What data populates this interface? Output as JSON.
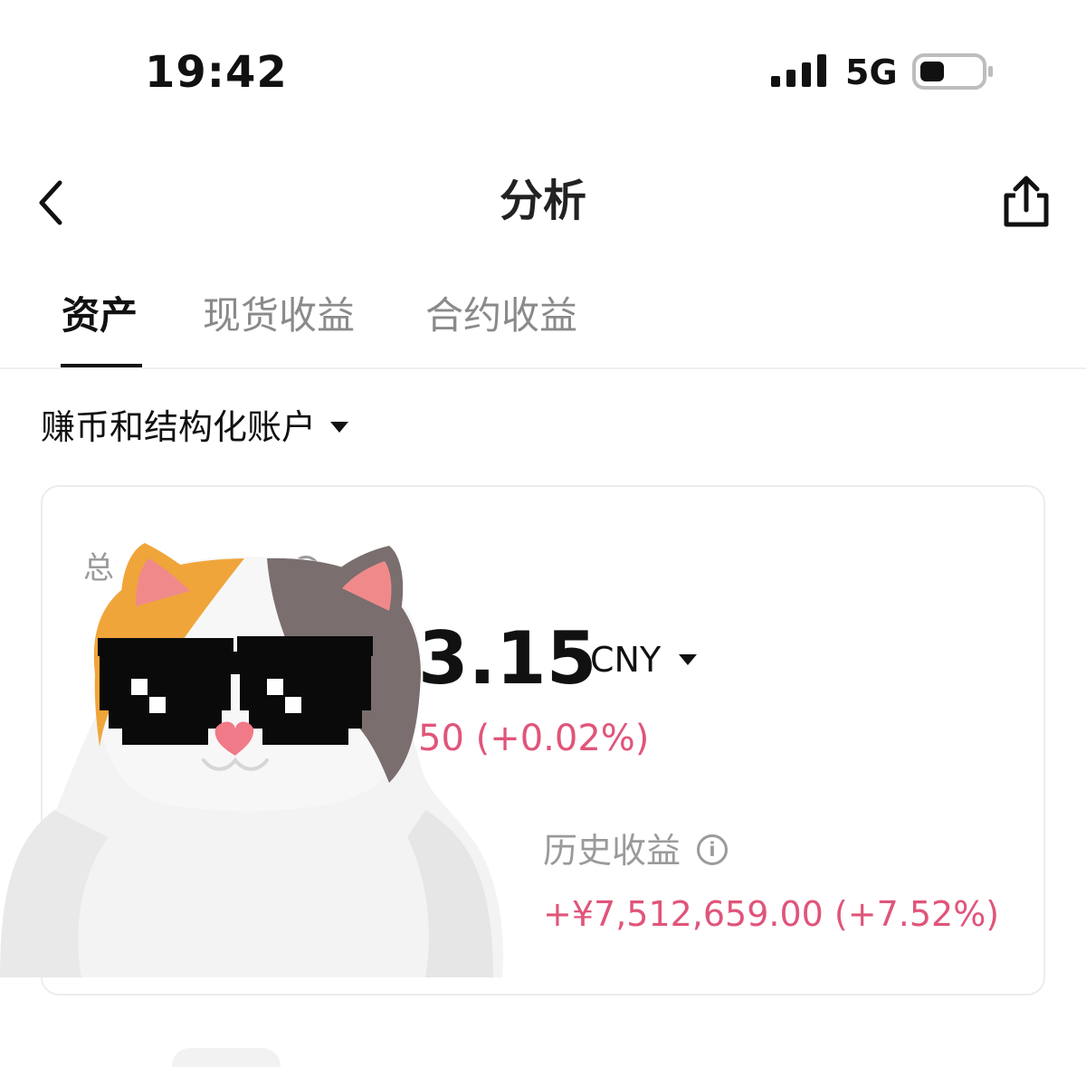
{
  "status_bar": {
    "time": "19:42",
    "network": "5G",
    "battery_level": 0.3
  },
  "nav": {
    "title": "分析",
    "back_icon": "chevron-left-icon",
    "share_icon": "share-icon"
  },
  "tabs": [
    {
      "label": "资产",
      "active": true
    },
    {
      "label": "现货收益",
      "active": false
    },
    {
      "label": "合约收益",
      "active": false
    }
  ],
  "account_selector": {
    "label": "赚币和结构化账户"
  },
  "card": {
    "total_label": "总",
    "total_value_visible": "3.15",
    "currency": "CNY",
    "daily_change_visible": "50 (+0.02%)",
    "history_label": "历史收益",
    "history_value": "+¥7,512,659.00 (+7.52%)"
  },
  "colors": {
    "accent_red": "#e0557a",
    "text_primary": "#111111",
    "text_secondary": "#9a9a9a"
  }
}
